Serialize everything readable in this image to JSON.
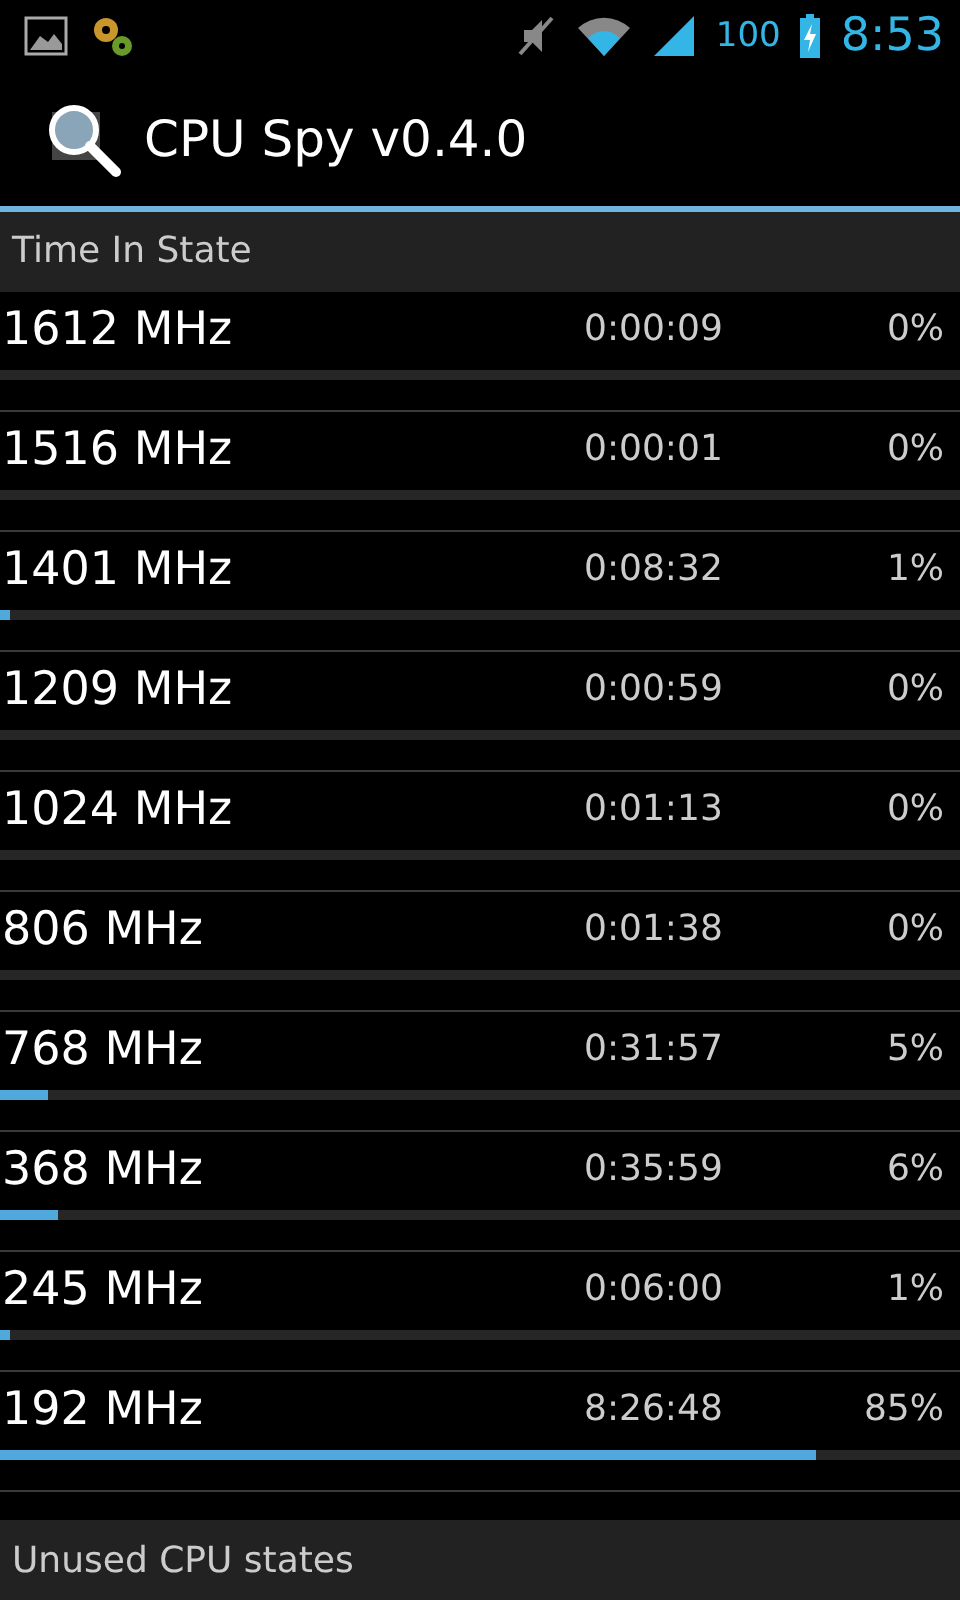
{
  "status_bar": {
    "battery": "100",
    "time": "8:53"
  },
  "action_bar": {
    "title": "CPU Spy v0.4.0"
  },
  "sections": [
    {
      "title": "Time In State"
    }
  ],
  "states": [
    {
      "frequency": "1612 MHz",
      "time": "0:00:09",
      "percent": "0%",
      "level": 0.0
    },
    {
      "frequency": "1516 MHz",
      "time": "0:00:01",
      "percent": "0%",
      "level": 0.0
    },
    {
      "frequency": "1401 MHz",
      "time": "0:08:32",
      "percent": "1%",
      "level": 0.01
    },
    {
      "frequency": "1209 MHz",
      "time": "0:00:59",
      "percent": "0%",
      "level": 0.0
    },
    {
      "frequency": "1024 MHz",
      "time": "0:01:13",
      "percent": "0%",
      "level": 0.0
    },
    {
      "frequency": "806 MHz",
      "time": "0:01:38",
      "percent": "0%",
      "level": 0.0
    },
    {
      "frequency": "768 MHz",
      "time": "0:31:57",
      "percent": "5%",
      "level": 0.05
    },
    {
      "frequency": "368 MHz",
      "time": "0:35:59",
      "percent": "6%",
      "level": 0.06
    },
    {
      "frequency": "245 MHz",
      "time": "0:06:00",
      "percent": "1%",
      "level": 0.01
    },
    {
      "frequency": "192 MHz",
      "time": "8:26:48",
      "percent": "85%",
      "level": 0.85
    }
  ],
  "footer_section": {
    "title": "Unused CPU states"
  }
}
